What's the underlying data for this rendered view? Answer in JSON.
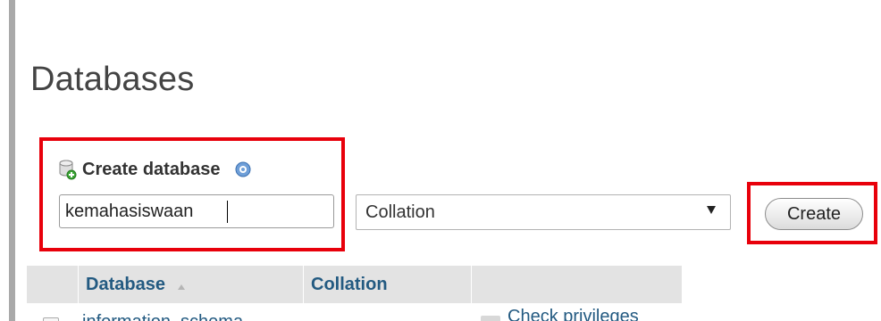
{
  "page": {
    "title": "Databases"
  },
  "create_database": {
    "label": "Create database",
    "name_input_value": "kemahasiswaan",
    "collation_select_value": "Collation",
    "create_button_label": "Create",
    "icons": {
      "database": "database-add-icon",
      "help": "help-icon"
    }
  },
  "table": {
    "columns": [
      {
        "label": "Database",
        "sort": "ascending"
      },
      {
        "label": "Collation"
      },
      {
        "label": ""
      }
    ],
    "rows": [
      {
        "database": "information_schema",
        "action": "Check privileges"
      }
    ]
  },
  "colors": {
    "highlight": "#e8000b",
    "link": "#235a81",
    "header_bg": "#e3e3e3",
    "left_rule": "#a9a9a9"
  }
}
